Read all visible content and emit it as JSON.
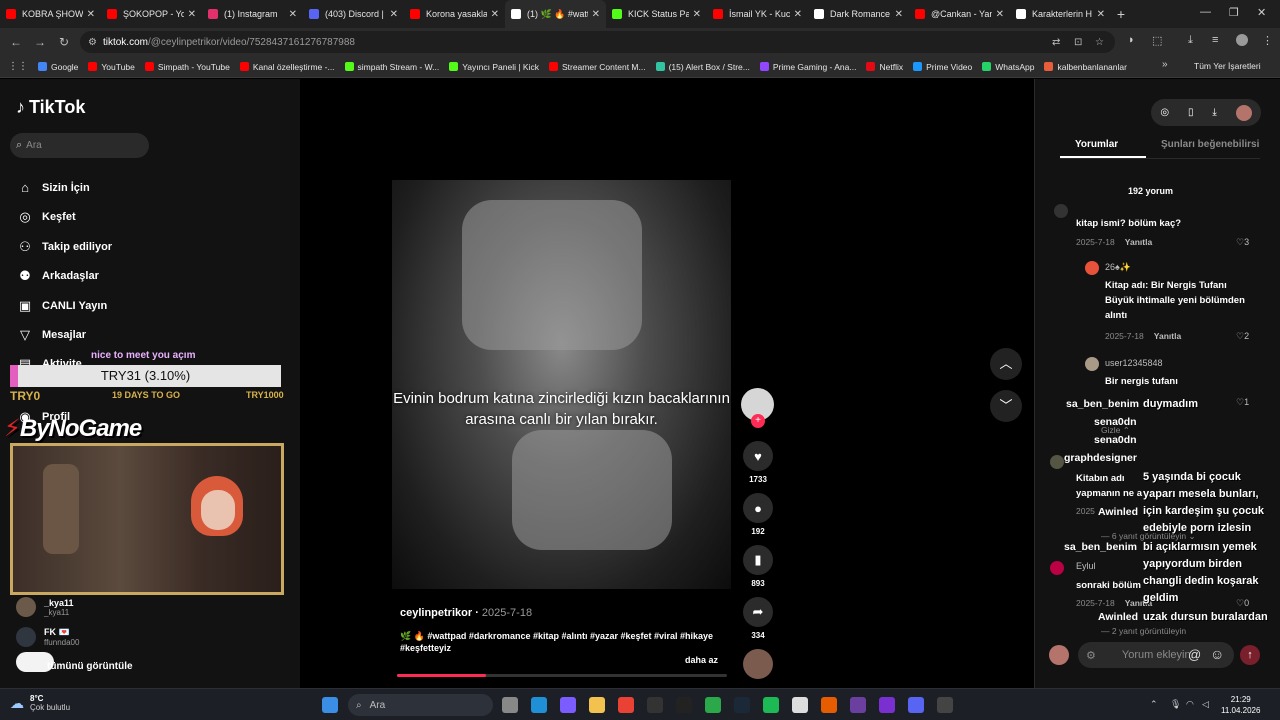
{
  "browser": {
    "tabs": [
      {
        "title": "KOBRA ŞHOW",
        "color": "#ff0000"
      },
      {
        "title": "ŞOKOPOP - Yo",
        "color": "#ff0000"
      },
      {
        "title": "(1) Instagram",
        "color": "#e1306c"
      },
      {
        "title": "(403) Discord |",
        "color": "#5865f2"
      },
      {
        "title": "Korona yasakla",
        "color": "#ff0000"
      },
      {
        "title": "(1) 🌿 🔥 #watt",
        "color": "#ffffff"
      },
      {
        "title": "KICK Status Pa",
        "color": "#53fc18"
      },
      {
        "title": "İsmail YK - Kuc",
        "color": "#ff0000"
      },
      {
        "title": "Dark Romance",
        "color": "#ffffff"
      },
      {
        "title": "@Cankan - Yan",
        "color": "#ff0000"
      },
      {
        "title": "Karakterlerin H",
        "color": "#ffffff"
      }
    ],
    "url_host": "tiktok.com",
    "url_path": "/@ceylinpetrikor/video/7528437161276787988",
    "bookmarks": [
      {
        "label": "Google",
        "color": "#4285f4"
      },
      {
        "label": "YouTube",
        "color": "#ff0000"
      },
      {
        "label": "Simpath - YouTube",
        "color": "#ff0000"
      },
      {
        "label": "Kanal özelleştirme -...",
        "color": "#ff0000"
      },
      {
        "label": "simpath Stream - W...",
        "color": "#53fc18"
      },
      {
        "label": "Yayıncı Paneli | Kick",
        "color": "#53fc18"
      },
      {
        "label": "Streamer Content M...",
        "color": "#ff0000"
      },
      {
        "label": "(15) Alert Box / Stre...",
        "color": "#31c3a2"
      },
      {
        "label": "Prime Gaming - Ana...",
        "color": "#9146ff"
      },
      {
        "label": "Netflix",
        "color": "#e50914"
      },
      {
        "label": "Prime Video",
        "color": "#1a98ff"
      },
      {
        "label": "WhatsApp",
        "color": "#25d366"
      },
      {
        "label": "kalbenbanlananlar",
        "color": "#e85d3a"
      }
    ],
    "all_bookmarks": "Tüm Yer İşaretleri"
  },
  "sidebar": {
    "logo": "TikTok",
    "search_placeholder": "Ara",
    "nav": [
      {
        "label": "Sizin İçin",
        "icon": "home-icon"
      },
      {
        "label": "Keşfet",
        "icon": "compass-icon"
      },
      {
        "label": "Takip ediliyor",
        "icon": "following-icon"
      },
      {
        "label": "Arkadaşlar",
        "icon": "friends-icon"
      },
      {
        "label": "CANLI Yayın",
        "icon": "live-icon"
      },
      {
        "label": "Mesajlar",
        "icon": "messages-icon"
      },
      {
        "label": "Aktivite",
        "icon": "activity-icon"
      },
      {
        "label": "Profil",
        "icon": "profile-icon"
      }
    ],
    "following": [
      {
        "name": "_kya11",
        "handle": "_kya11"
      },
      {
        "name": "FK 💌",
        "handle": "ffunnda00"
      }
    ],
    "see_all": "tümünü görüntüle"
  },
  "overlay": {
    "donation_message": "nice to meet you açım",
    "goal_label": "TRY31 (3.10%)",
    "goal_progress": 0.031,
    "goal_start": "TRY0",
    "goal_days": "19 DAYS TO GO",
    "goal_end": "TRY1000",
    "brand": "ByNoGame"
  },
  "video": {
    "caption": "Evinin bodrum katına zincirlediği kızın bacaklarının arasına canlı bir yılan bırakır.",
    "author": "ceylinpetrikor",
    "date": "2025-7-18",
    "description": "🌿 🔥 #wattpad #darkromance #kitap #alıntı #yazar #keşfet #viral #hikaye #keşfetteyiz",
    "less": "daha az",
    "progress": 0.27,
    "likes": "1733",
    "comments": "192",
    "saves": "893",
    "shares": "334"
  },
  "comments_panel": {
    "tab_comments": "Yorumlar",
    "tab_liked": "Şunları beğenebilirsi",
    "count": "192 yorum",
    "input_placeholder": "Yorum ekleyin...",
    "items": [
      {
        "text": "kitap ismi? bölüm kaç?",
        "date": "2025-7-18",
        "reply": "Yanıtla",
        "likes": "3"
      },
      {
        "user": "26♠✨",
        "text": "Kitap adı: Bir Nergis Tufanı Büyük ihtimalle yeni bölümden alıntı",
        "date": "2025-7-18",
        "reply": "Yanıtla",
        "likes": "2"
      },
      {
        "user": "user12345848",
        "text": "Bir nergis tufanı",
        "likes": "1"
      },
      {
        "text": "Kitabın adı",
        "text2": "yapmanın ne a",
        "date": "2025",
        "replies": "6 yanıt görüntüleyin"
      },
      {
        "user": "Eylul",
        "text": "sonraki bölüm",
        "date": "2025-7-18",
        "reply": "Yanıtla",
        "likes": "0",
        "replies": "2 yanıt görüntüleyin"
      }
    ],
    "hide": "Gizle"
  },
  "chat": [
    {
      "name": "sa_ben_benim",
      "color": "#e23b6b",
      "msg": "duymadım"
    },
    {
      "name": "sena0dn",
      "color": "#7fb3ff",
      "msg": ""
    },
    {
      "name": "sena0dn",
      "color": "#7fb3ff",
      "msg": ""
    },
    {
      "name": "graphdesigner",
      "color": "#e23b6b",
      "msg": ""
    },
    {
      "name": "Awinled",
      "color": "#b36bff",
      "msg": "5 yaşında bi çocuk yaparı mesela bunları, için kardeşim şu çocuk edebiyle porn izlesin"
    },
    {
      "name": "sa_ben_benim",
      "color": "#e23b6b",
      "msg": "bi açıklarmısın yemek yapıyordum birden changli dedin koşarak geldim"
    },
    {
      "name": "Awinled",
      "color": "#b36bff",
      "msg": "uzak dursun buralardan"
    }
  ],
  "taskbar": {
    "temp": "8°C",
    "weather": "Çok bulutlu",
    "search": "Ara",
    "time": "21:29",
    "date": "11.04.2026"
  }
}
